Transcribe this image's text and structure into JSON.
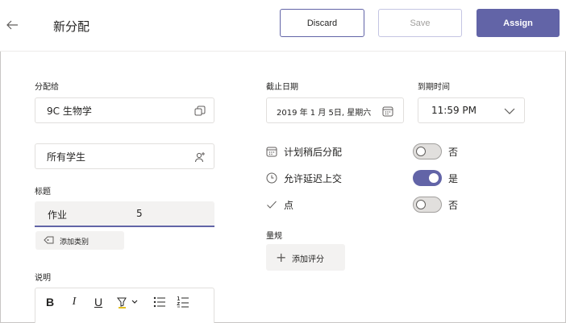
{
  "header": {
    "title": "新分配",
    "discard_label": "Discard",
    "save_label": "Save",
    "assign_label": "Assign"
  },
  "left": {
    "assign_to_label": "分配给",
    "class_value": "9C 生物学",
    "students_value": "所有学生",
    "title_label": "标题",
    "title_value": "作业",
    "title_cursor_text": "5",
    "add_category_label": "添加类别",
    "description_label": "说明",
    "toolbar": {
      "bold": "B",
      "italic": "I",
      "underline": "U"
    }
  },
  "right": {
    "due_date_label": "截止日期",
    "due_date_value": "2019 年 1 月 5日, 星期六",
    "due_time_label": "到期时间",
    "due_time_value": "11:59 PM",
    "options": [
      {
        "label": "计划稍后分配",
        "state": "否",
        "on": false
      },
      {
        "label": "允许延迟上交",
        "state": "是",
        "on": true
      },
      {
        "label": "点",
        "state": "否",
        "on": false
      }
    ],
    "rubric_label": "量规",
    "add_rubric_label": "添加评分"
  },
  "colors": {
    "accent": "#6264a7",
    "border": "#e1dfdd",
    "chip_bg": "#f3f2f1"
  }
}
